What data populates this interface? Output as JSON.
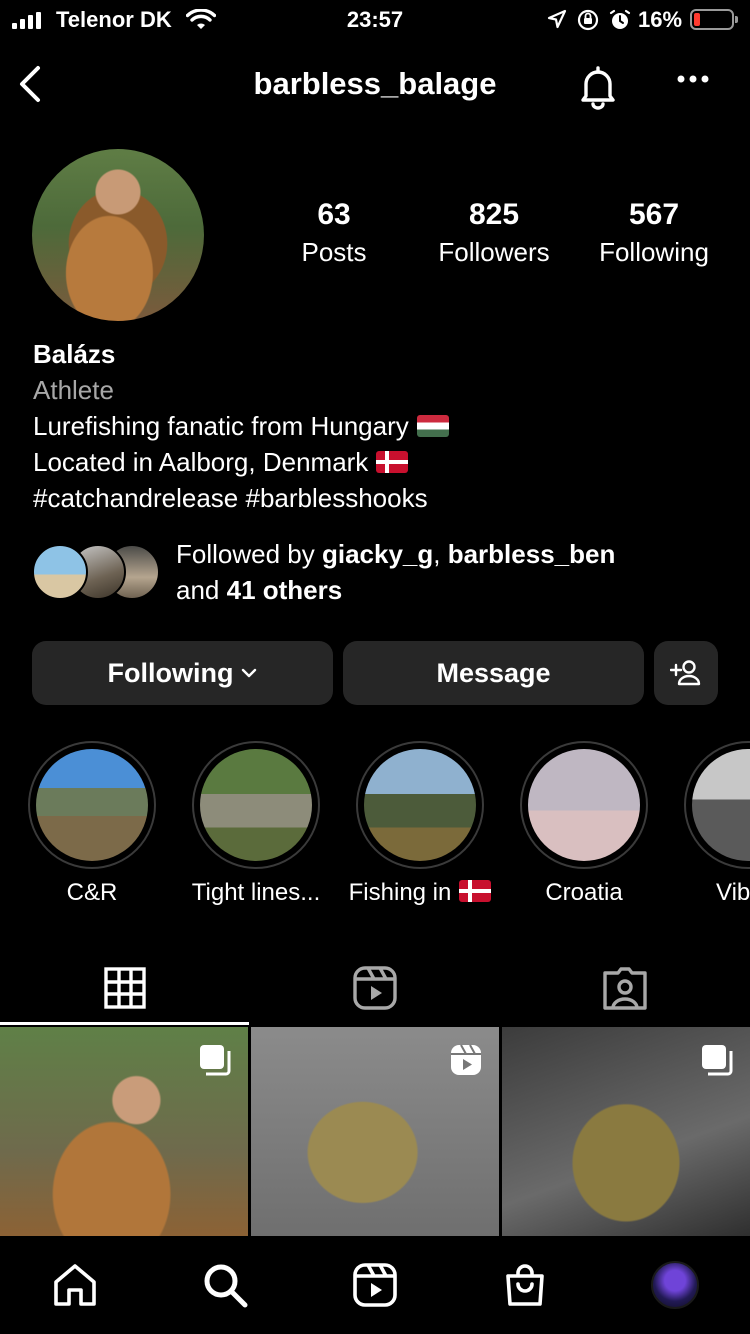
{
  "status_bar": {
    "carrier": "Telenor DK",
    "time": "23:57",
    "battery_pct": "16%",
    "icons": [
      "signal-icon",
      "wifi-icon",
      "location-icon",
      "orientation-lock-icon",
      "alarm-icon",
      "battery-icon"
    ]
  },
  "nav": {
    "username": "barbless_balage",
    "icons": [
      "back-icon",
      "bell-icon",
      "more-icon"
    ]
  },
  "stats": [
    {
      "value": "63",
      "label": "Posts"
    },
    {
      "value": "825",
      "label": "Followers"
    },
    {
      "value": "567",
      "label": "Following"
    }
  ],
  "bio": {
    "name": "Balázs",
    "category": "Athlete",
    "line1": "Lurefishing fanatic from Hungary",
    "line2": "Located in Aalborg, Denmark",
    "line3": "#catchandrelease #barblesshooks"
  },
  "followed_by": {
    "prefix": "Followed by ",
    "user1": "giacky_g",
    "sep": ", ",
    "user2": "barbless_ben",
    "and": "and ",
    "others": "41 others"
  },
  "buttons": {
    "following": "Following",
    "message": "Message"
  },
  "highlights": [
    {
      "label": "C&R"
    },
    {
      "label": "Tight lines..."
    },
    {
      "label": "Fishing in"
    },
    {
      "label": "Croatia"
    },
    {
      "label": "Vib"
    }
  ],
  "tabs": [
    "grid-icon",
    "reels-icon",
    "tagged-icon"
  ],
  "active_tab": "grid",
  "colors": {
    "background": "#000000",
    "button": "#262626",
    "secondary_text": "#a8a8a8",
    "battery_low": "#ff3b30"
  }
}
